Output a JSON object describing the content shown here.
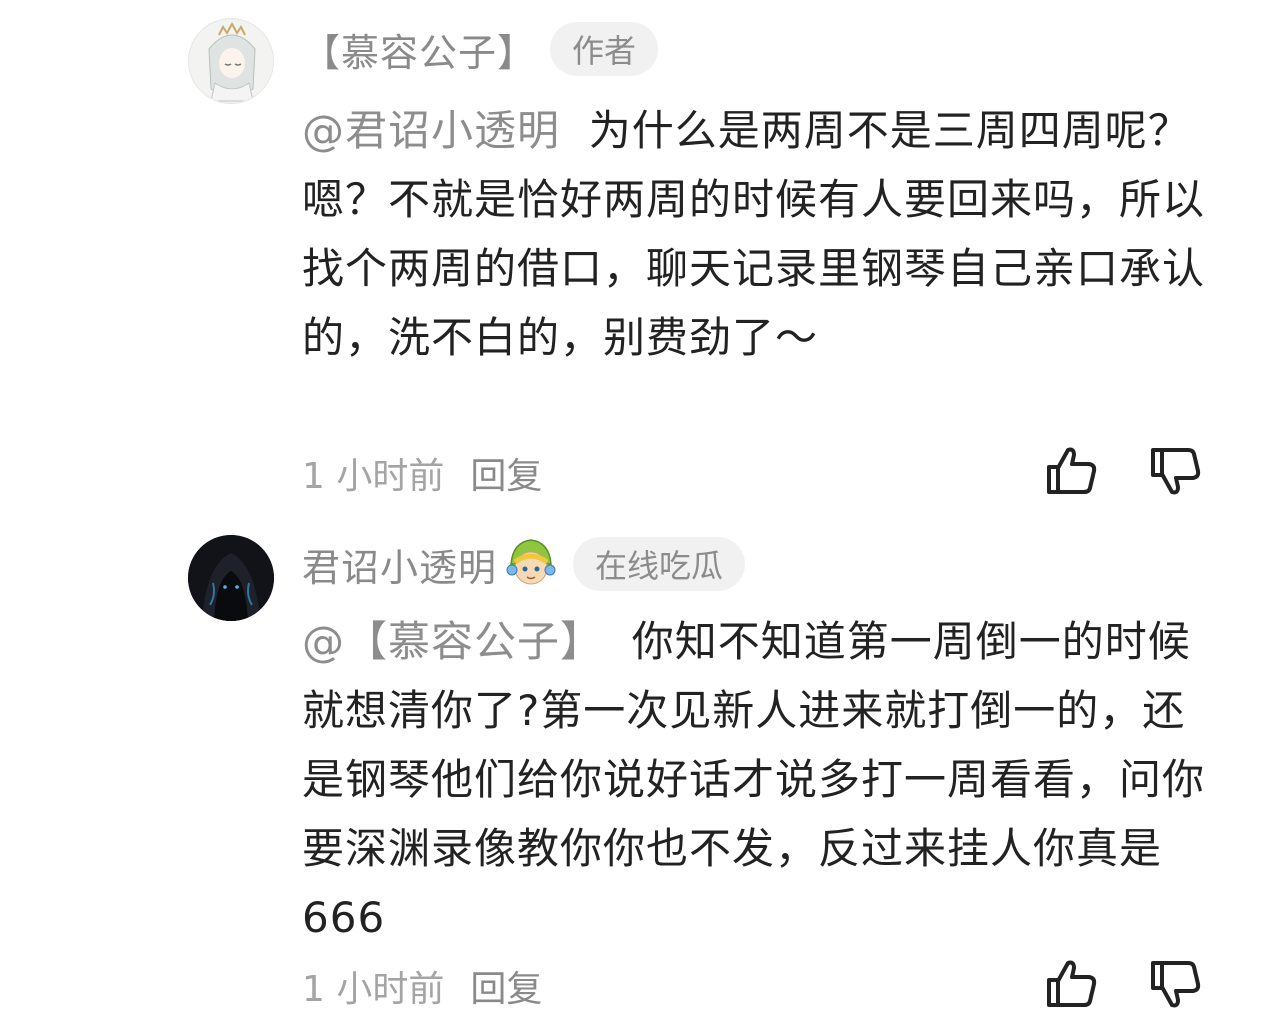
{
  "comments": [
    {
      "avatar_icon": "anime-character-avatar",
      "username": "【慕容公子】",
      "badge": "作者",
      "mention": "@君诏小透明",
      "text": "为什么是两周不是三周四周呢？嗯？不就是恰好两周的时候有人要回来吗，所以找个两周的借口，聊天记录里钢琴自己亲口承认的，洗不白的，别费劲了～",
      "time": "1 小时前",
      "reply_label": "回复"
    },
    {
      "avatar_icon": "dark-hooded-figure-avatar",
      "username": "君诏小透明",
      "emoji_icon": "green-cap-character-emoji",
      "badge": "在线吃瓜",
      "mention": "@【慕容公子】",
      "text": "你知不知道第一周倒一的时候就想清你了?第一次见新人进来就打倒一的，还是钢琴他们给你说好话才说多打一周看看，问你要深渊录像教你你也不发，反过来挂人你真是666",
      "time": "1 小时前",
      "reply_label": "回复"
    }
  ],
  "colors": {
    "text": "#222222",
    "secondary": "#8a8a8a",
    "badge_bg": "#f1f1f1"
  }
}
